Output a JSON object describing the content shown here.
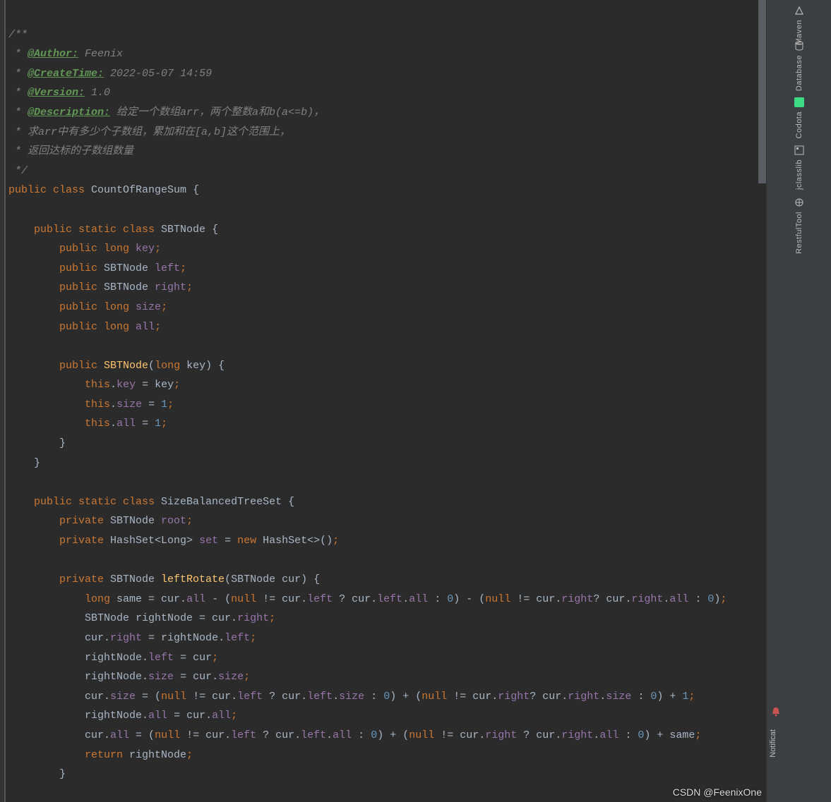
{
  "doc": {
    "author_tag": "@Author:",
    "author_val": " Feenix",
    "create_tag": "@CreateTime:",
    "create_val": " 2022-05-07 14:59",
    "version_tag": "@Version:",
    "version_val": " 1.0",
    "desc_tag": "@Description:",
    "desc_val": " 给定一个数组arr，两个整数a和b(a<=b)，",
    "line5": " * 求arr中有多少个子数组，累加和在[a,b]这个范围上，",
    "line6": " * 返回达标的子数组数量",
    "open": "/**",
    "close": " */",
    "star": " * "
  },
  "code": {
    "class_decl_pre": "public class ",
    "class_name": "CountOfRangeSum",
    "inner1_decl": "    public static class ",
    "inner1_name": "SBTNode",
    "f_key": "        public long key;",
    "f_left": "        public SBTNode left;",
    "f_right": "        public SBTNode right;",
    "f_size": "        public long size;",
    "f_all": "        public long all;",
    "ctor_sig": "        public SBTNode(long key) {",
    "ctor_b1": "            this.key = key;",
    "ctor_b2": "            this.size = 1;",
    "ctor_b3": "            this.all = 1;",
    "inner2_decl": "    public static class ",
    "inner2_name": "SizeBalancedTreeSet",
    "root": "        private SBTNode root;",
    "set": "        private HashSet<Long> set = new HashSet<>();",
    "lr_sig": "        private SBTNode leftRotate(SBTNode cur) {",
    "lr_b1": "            long same = cur.all - (null != cur.left ? cur.left.all : 0) - (null != cur.right? cur.right.all : 0);",
    "lr_b2": "            SBTNode rightNode = cur.right;",
    "lr_b3": "            cur.right = rightNode.left;",
    "lr_b4": "            rightNode.left = cur;",
    "lr_b5": "            rightNode.size = cur.size;",
    "lr_b6": "            cur.size = (null != cur.left ? cur.left.size : 0) + (null != cur.right? cur.right.size : 0) + 1;",
    "lr_b7": "            rightNode.all = cur.all;",
    "lr_b8": "            cur.all = (null != cur.left ? cur.left.all : 0) + (null != cur.right ? cur.right.all : 0) + same;",
    "lr_b9": "            return rightNode;",
    "close_brace": "        }",
    "close_inner": "    }"
  },
  "tools": {
    "maven": "Maven",
    "database": "Database",
    "codota": "Codota",
    "jclasslib": "jclasslib",
    "restful": "RestfulTool",
    "notif": "Notificat"
  },
  "watermark": "CSDN @FeenixOne"
}
